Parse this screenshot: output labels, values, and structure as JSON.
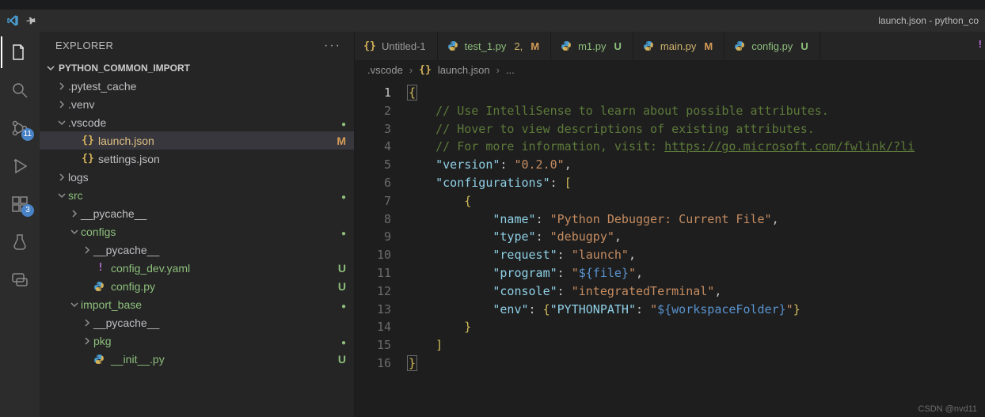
{
  "window": {
    "title": "launch.json - python_co"
  },
  "activity": {
    "scm_badge": "11",
    "ext_badge": "3"
  },
  "explorer": {
    "title": "EXPLORER",
    "project": "PYTHON_COMMON_IMPORT",
    "tree": [
      {
        "depth": 0,
        "kind": "folder",
        "open": false,
        "label": ".pytest_cache"
      },
      {
        "depth": 0,
        "kind": "folder",
        "open": false,
        "label": ".venv"
      },
      {
        "depth": 0,
        "kind": "folder",
        "open": true,
        "label": ".vscode",
        "status": "dot"
      },
      {
        "depth": 1,
        "kind": "file",
        "icon": "braces",
        "label": "launch.json",
        "status": "M",
        "selected": true
      },
      {
        "depth": 1,
        "kind": "file",
        "icon": "braces",
        "label": "settings.json"
      },
      {
        "depth": 0,
        "kind": "folder",
        "open": false,
        "label": "logs"
      },
      {
        "depth": 0,
        "kind": "folder",
        "open": true,
        "label": "src",
        "green": true,
        "status": "dot"
      },
      {
        "depth": 1,
        "kind": "folder",
        "open": false,
        "label": "__pycache__"
      },
      {
        "depth": 1,
        "kind": "folder",
        "open": true,
        "label": "configs",
        "green": true,
        "status": "dot"
      },
      {
        "depth": 2,
        "kind": "folder",
        "open": false,
        "label": "__pycache__"
      },
      {
        "depth": 2,
        "kind": "file",
        "icon": "yaml",
        "label": "config_dev.yaml",
        "green": true,
        "status": "U"
      },
      {
        "depth": 2,
        "kind": "file",
        "icon": "py",
        "label": "config.py",
        "green": true,
        "status": "U"
      },
      {
        "depth": 1,
        "kind": "folder",
        "open": true,
        "label": "import_base",
        "green": true,
        "status": "dot"
      },
      {
        "depth": 2,
        "kind": "folder",
        "open": false,
        "label": "__pycache__"
      },
      {
        "depth": 2,
        "kind": "folder",
        "open": false,
        "label": "pkg",
        "green": true,
        "status": "dot"
      },
      {
        "depth": 2,
        "kind": "file",
        "icon": "py",
        "label": "__init__.py",
        "green": true,
        "status": "U"
      }
    ]
  },
  "tabs": [
    {
      "icon": "braces",
      "label": "Untitled-1"
    },
    {
      "icon": "py",
      "label": "test_1.py",
      "green": true,
      "suffix_num": "2,",
      "suffix": "M"
    },
    {
      "icon": "py",
      "label": "m1.py",
      "green": true,
      "suffix": "U"
    },
    {
      "icon": "py",
      "label": "main.py",
      "suffix": "M",
      "mcolor": true
    },
    {
      "icon": "py",
      "label": "config.py",
      "green": true,
      "suffix": "U"
    }
  ],
  "tabs_extra": "!",
  "breadcrumbs": {
    "a": ".vscode",
    "b": "launch.json",
    "c": "..."
  },
  "code": {
    "lines": 16,
    "l1": "{",
    "c1": "// Use IntelliSense to learn about possible attributes.",
    "c2": "// Hover to view descriptions of existing attributes.",
    "c3a": "// For more information, visit: ",
    "c3b": "https://go.microsoft.com/fwlink/?li",
    "k_version": "\"version\"",
    "v_version": "\"0.2.0\"",
    "k_configs": "\"configurations\"",
    "k_name": "\"name\"",
    "v_name": "\"Python Debugger: Current File\"",
    "k_type": "\"type\"",
    "v_type": "\"debugpy\"",
    "k_request": "\"request\"",
    "v_request": "\"launch\"",
    "k_program": "\"program\"",
    "v_program_a": "\"",
    "v_program_b": "${file}",
    "v_program_c": "\"",
    "k_console": "\"console\"",
    "v_console": "\"integratedTerminal\"",
    "k_env": "\"env\"",
    "k_pp": "\"PYTHONPATH\"",
    "v_pp_a": "\"",
    "v_pp_b": "${workspaceFolder}",
    "v_pp_c": "\"",
    "l7": "{",
    "l14": "}",
    "l15": "]",
    "l16": "}"
  },
  "footer": "CSDN @nvd11"
}
